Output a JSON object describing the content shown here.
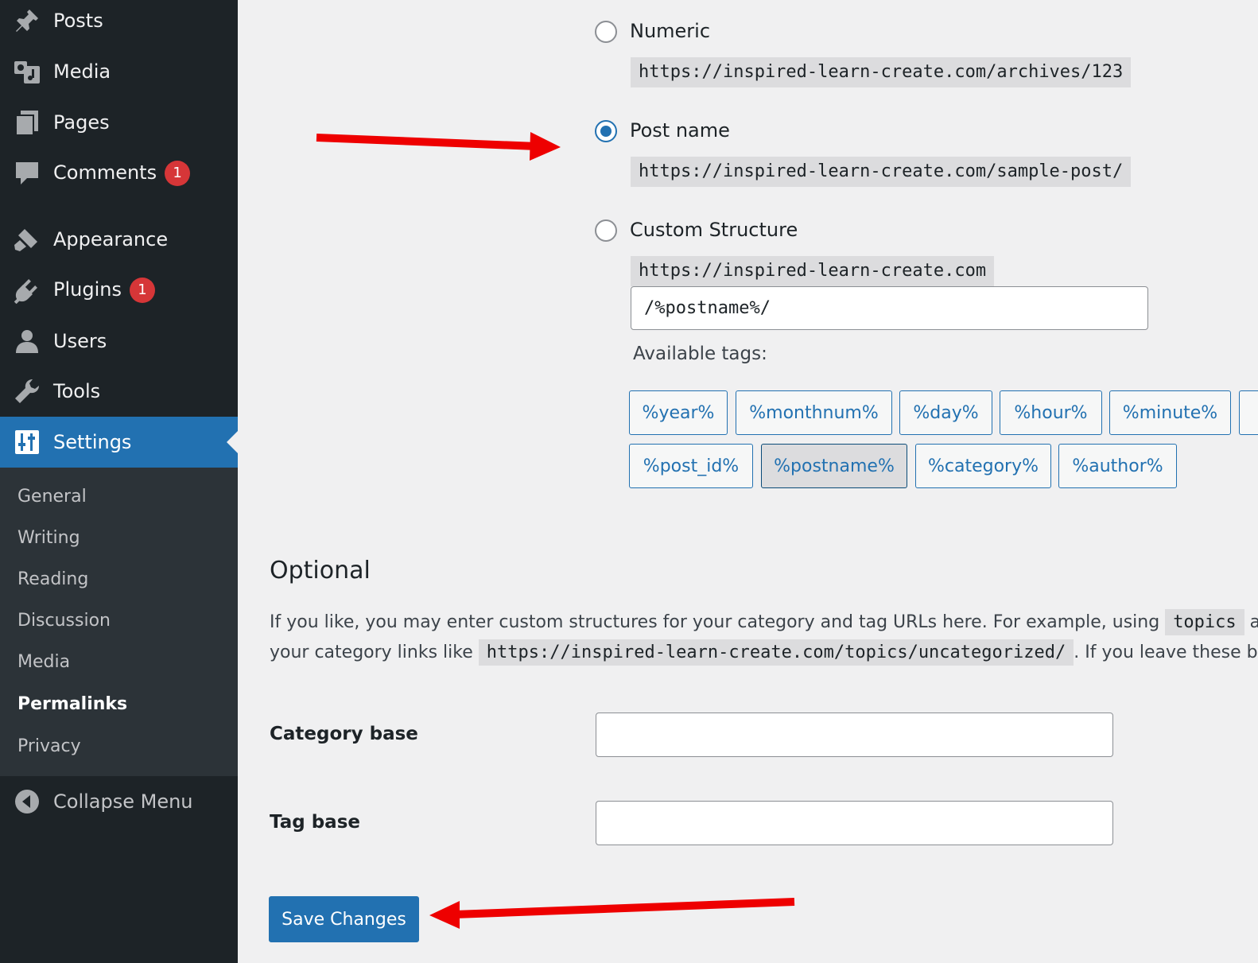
{
  "sidebar": {
    "items": [
      {
        "label": "Posts",
        "icon": "pin-icon"
      },
      {
        "label": "Media",
        "icon": "media-icon"
      },
      {
        "label": "Pages",
        "icon": "pages-icon"
      },
      {
        "label": "Comments",
        "icon": "comment-icon",
        "badge": "1"
      },
      {
        "label": "Appearance",
        "icon": "brush-icon"
      },
      {
        "label": "Plugins",
        "icon": "plugin-icon",
        "badge": "1"
      },
      {
        "label": "Users",
        "icon": "user-icon"
      },
      {
        "label": "Tools",
        "icon": "wrench-icon"
      },
      {
        "label": "Settings",
        "icon": "settings-icon"
      }
    ],
    "submenu": [
      "General",
      "Writing",
      "Reading",
      "Discussion",
      "Media",
      "Permalinks",
      "Privacy"
    ],
    "current_submenu": "Permalinks",
    "collapse_label": "Collapse Menu"
  },
  "permalink_options": [
    {
      "label": "Numeric",
      "example": "https://inspired-learn-create.com/archives/123",
      "selected": false
    },
    {
      "label": "Post name",
      "example": "https://inspired-learn-create.com/sample-post/",
      "selected": true
    },
    {
      "label": "Custom Structure",
      "example": "https://inspired-learn-create.com",
      "selected": false
    }
  ],
  "custom_structure_value": "/%postname%/",
  "available_tags_label": "Available tags:",
  "tags": [
    "%year%",
    "%monthnum%",
    "%day%",
    "%hour%",
    "%minute%",
    "%post_id%",
    "%postname%",
    "%category%",
    "%author%"
  ],
  "active_tag": "%postname%",
  "optional": {
    "title": "Optional",
    "line1_text": "If you like, you may enter custom structures for your category and tag URLs here. For example, using",
    "line1_code": "topics",
    "line1_tail": "as yo",
    "line2_text": "your category links like",
    "line2_code": "https://inspired-learn-create.com/topics/uncategorized/",
    "line2_tail": ". If you leave these bl"
  },
  "fields": {
    "category_base_label": "Category base",
    "category_base_value": "",
    "tag_base_label": "Tag base",
    "tag_base_value": ""
  },
  "save_label": "Save Changes",
  "colors": {
    "accent": "#2271b1",
    "sidebar": "#1d2327",
    "badge": "#d63638",
    "arrow": "#ee0000"
  }
}
